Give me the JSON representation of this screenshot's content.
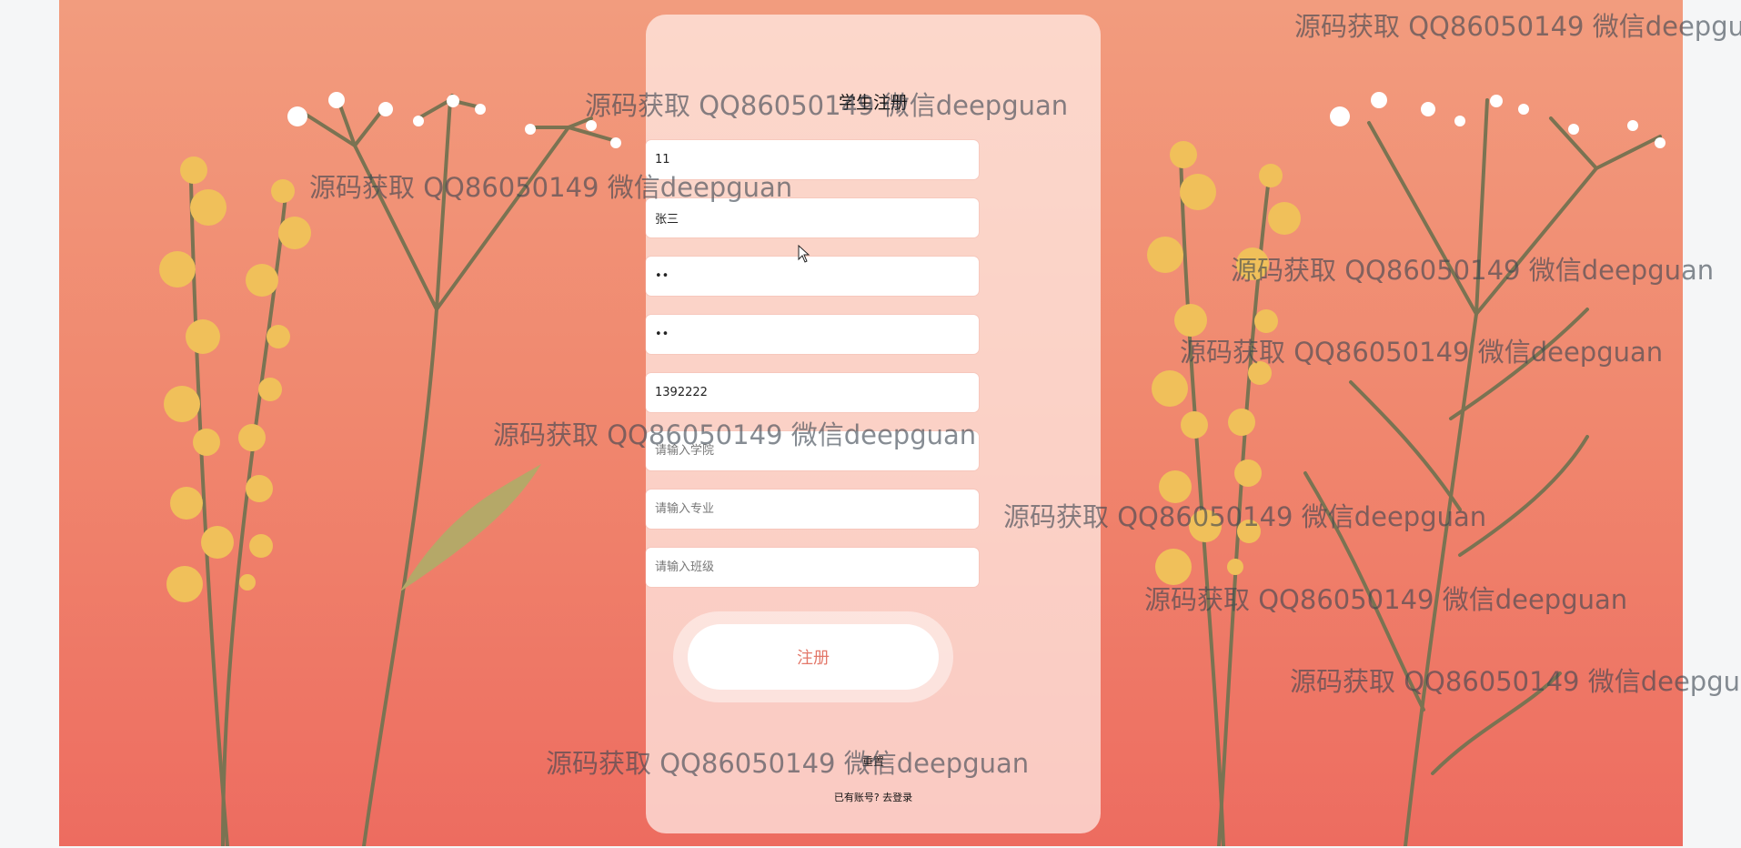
{
  "form": {
    "title": "学生注册",
    "fields": [
      {
        "name": "student-id-field",
        "value": "11",
        "placeholder": ""
      },
      {
        "name": "student-name-field",
        "value": "张三",
        "placeholder": ""
      },
      {
        "name": "password-field",
        "value": "••",
        "placeholder": ""
      },
      {
        "name": "confirm-password-field",
        "value": "••",
        "placeholder": ""
      },
      {
        "name": "phone-field",
        "value": "1392222",
        "placeholder": ""
      },
      {
        "name": "college-field",
        "value": "",
        "placeholder": "请输入学院"
      },
      {
        "name": "major-field",
        "value": "",
        "placeholder": "请输入专业"
      },
      {
        "name": "class-field",
        "value": "",
        "placeholder": "请输入班级"
      }
    ],
    "submit_label": "注册",
    "reset_label": "重置",
    "login_prompt": "已有账号?",
    "login_link": "去登录"
  },
  "watermark_text": "源码获取 QQ86050149 微信deepguan",
  "colors": {
    "bg_top": "#f29c7e",
    "bg_bottom": "#ed6c60",
    "accent": "#e3786a",
    "flower_yellow": "#f0c05a",
    "stem": "#7a7352"
  }
}
